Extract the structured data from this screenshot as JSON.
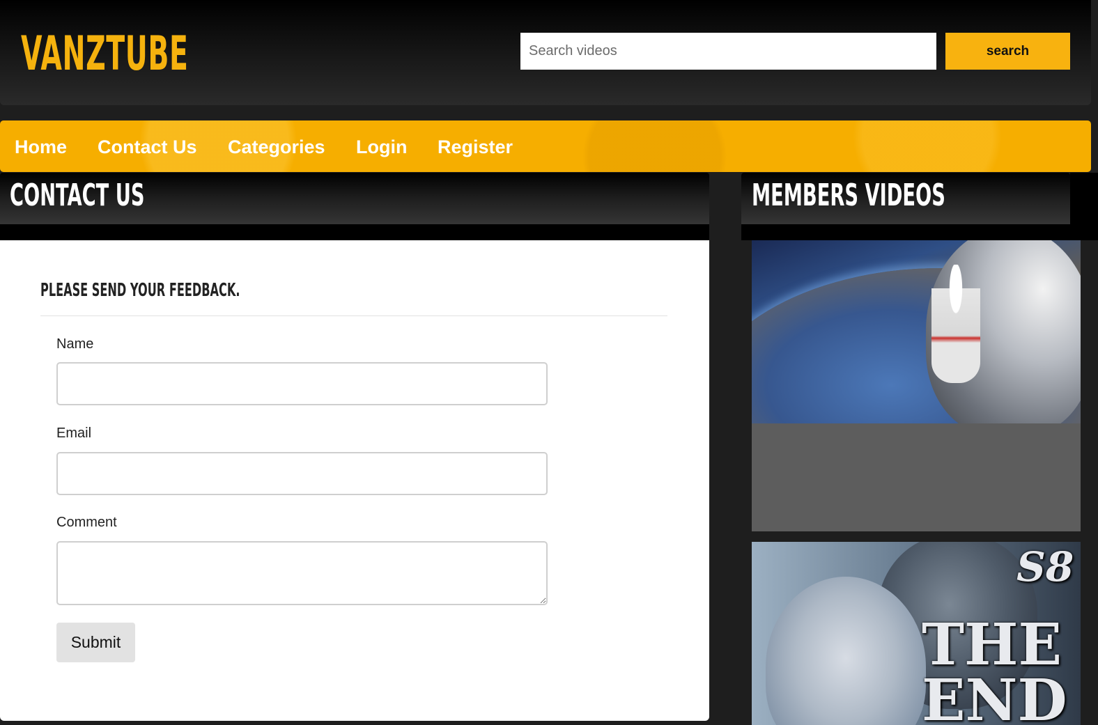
{
  "header": {
    "logo": "VANZTUBE",
    "search": {
      "placeholder": "Search videos",
      "value": ""
    },
    "search_button": "search"
  },
  "nav": {
    "items": [
      {
        "label": "Home"
      },
      {
        "label": "Contact Us"
      },
      {
        "label": "Categories"
      },
      {
        "label": "Login"
      },
      {
        "label": "Register"
      }
    ]
  },
  "contact": {
    "title": "CONTACT US",
    "heading": "PLEASE SEND YOUR FEEDBACK.",
    "fields": {
      "name_label": "Name",
      "email_label": "Email",
      "comment_label": "Comment"
    },
    "submit_label": "Submit"
  },
  "members": {
    "title": "MEMBERS VIDEOS",
    "videos": [
      {
        "thumbnail": "space-jump-thumbnail",
        "overlay_text": ""
      },
      {
        "thumbnail": "game-of-thrones-thumbnail",
        "overlay_text_1": "S8",
        "overlay_text_2": "THE",
        "overlay_text_3": "END"
      }
    ]
  },
  "colors": {
    "brand_yellow": "#f6ae00",
    "logo_yellow": "#f5b20e",
    "background": "#1e1e1e"
  }
}
